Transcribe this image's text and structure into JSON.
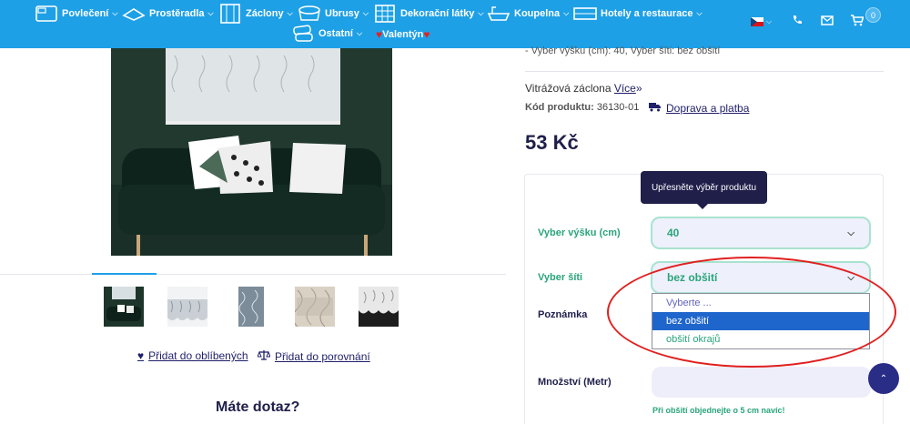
{
  "nav": {
    "items": [
      {
        "label": "Povlečení",
        "icon": "bedding-icon"
      },
      {
        "label": "Prostěradla",
        "icon": "sheet-icon"
      },
      {
        "label": "Záclony",
        "icon": "curtain-icon"
      },
      {
        "label": "Ubrusy",
        "icon": "tablecloth-icon"
      },
      {
        "label": "Dekorační látky",
        "icon": "fabric-icon"
      },
      {
        "label": "Koupelna",
        "icon": "bathtub-icon"
      },
      {
        "label": "Hotely a restaurace",
        "icon": "bed-icon"
      },
      {
        "label": "Ostatní",
        "icon": "pillows-icon"
      },
      {
        "label": "Valentýn",
        "icon": "heart-icon"
      }
    ],
    "cart_count": "0",
    "language_flag": "cz-flag-icon"
  },
  "product": {
    "variant_line": "- Vyber výšku (cm): 40, Vyber šíti: bez obšití",
    "type_text": "Vitrážová záclona",
    "more_link": "Více",
    "code_label": "Kód produktu:",
    "code_value": "36130-01",
    "delivery_link": "Doprava a platba",
    "price": "53 Kč"
  },
  "gallery": {
    "favorite_link": "Přidat do oblíbených",
    "compare_link": "Přidat do porovnání",
    "question_heading": "Máte dotaz?"
  },
  "config": {
    "tooltip": "Upřesněte výběr produktu",
    "height_label": "Vyber výšku (cm)",
    "height_value": "40",
    "width_label": "Vyber šíti",
    "width_value": "bez obšití",
    "options": [
      "Vyberte ...",
      "bez obšití",
      "obšití okrajů"
    ],
    "note_label": "Poznámka",
    "qty_label": "Množství (Metr)",
    "hint": "Při obšití objednejte o 5 cm navíc!"
  },
  "colors": {
    "header_blue": "#1ea0e6",
    "accent_green": "#2aa57a",
    "navy": "#1f1f4a",
    "highlight_blue": "#1f66cc",
    "annotation_red": "#e02020"
  }
}
